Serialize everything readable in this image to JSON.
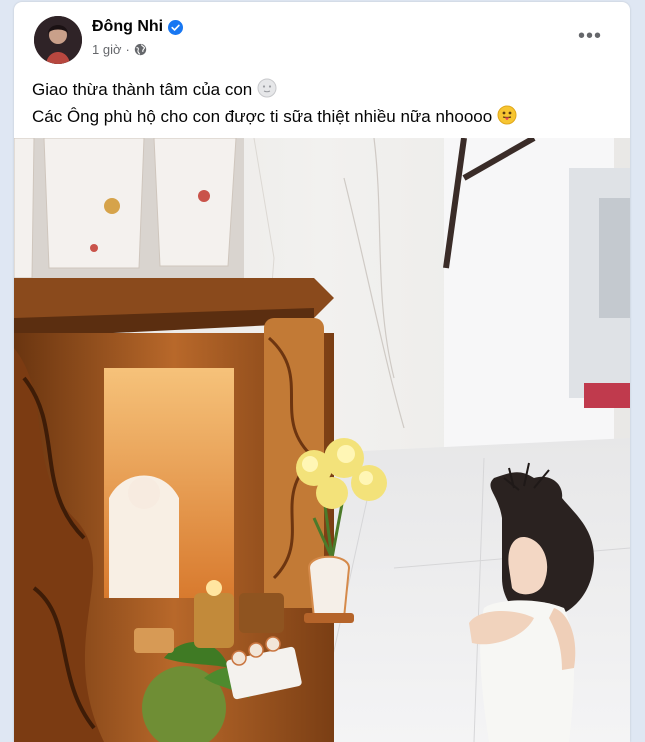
{
  "post": {
    "author": "Đông Nhi",
    "time": "1 giờ",
    "separator": "·",
    "privacy_icon": "globe-icon",
    "verified_icon": "verified-badge-icon",
    "more_icon": "more-options-icon",
    "more_label": "•••",
    "caption_lines": [
      "Giao thừa thành tâm của con",
      "Các Ông phù hộ cho con được ti sữa thiệt nhiều nữa nhoooo"
    ],
    "emoji": [
      "moon-face-emoji",
      "tongue-out-emoji"
    ]
  },
  "colors": {
    "verified": "#1877f2",
    "secondary_text": "#65676b",
    "page_background": "#dfe7f3"
  }
}
